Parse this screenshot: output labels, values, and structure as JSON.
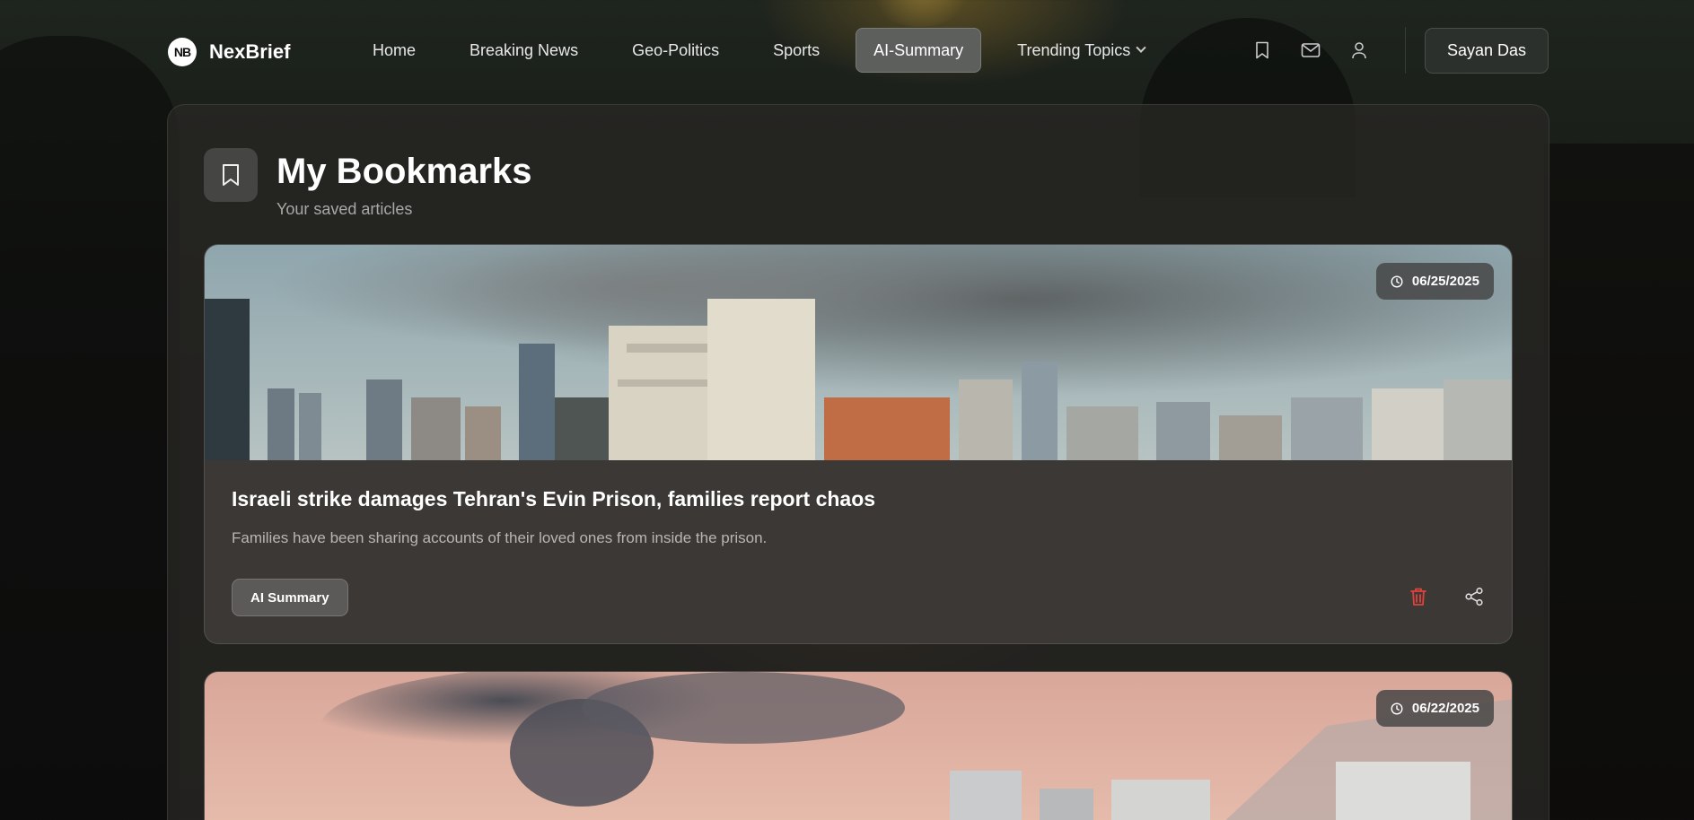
{
  "brand": {
    "logo_text": "NB",
    "name": "NexBrief"
  },
  "nav": {
    "links": [
      {
        "label": "Home",
        "active": false
      },
      {
        "label": "Breaking News",
        "active": false
      },
      {
        "label": "Geo-Politics",
        "active": false
      },
      {
        "label": "Sports",
        "active": false
      },
      {
        "label": "AI-Summary",
        "active": true
      },
      {
        "label": "Trending Topics",
        "active": false
      }
    ],
    "icons": [
      "bookmark-icon",
      "mail-icon",
      "user-icon"
    ],
    "user_name": "Sayan Das"
  },
  "page": {
    "title": "My Bookmarks",
    "subtitle": "Your saved articles",
    "header_icon": "bookmark-icon"
  },
  "bookmarks": [
    {
      "date": "06/25/2025",
      "title": "Israeli strike damages Tehran's Evin Prison, families report chaos",
      "description": "Families have been sharing accounts of their loved ones from inside the prison.",
      "ai_label": "AI Summary"
    },
    {
      "date": "06/22/2025"
    }
  ],
  "colors": {
    "delete": "#e0433b",
    "accent_active": "#5d5f5d"
  }
}
